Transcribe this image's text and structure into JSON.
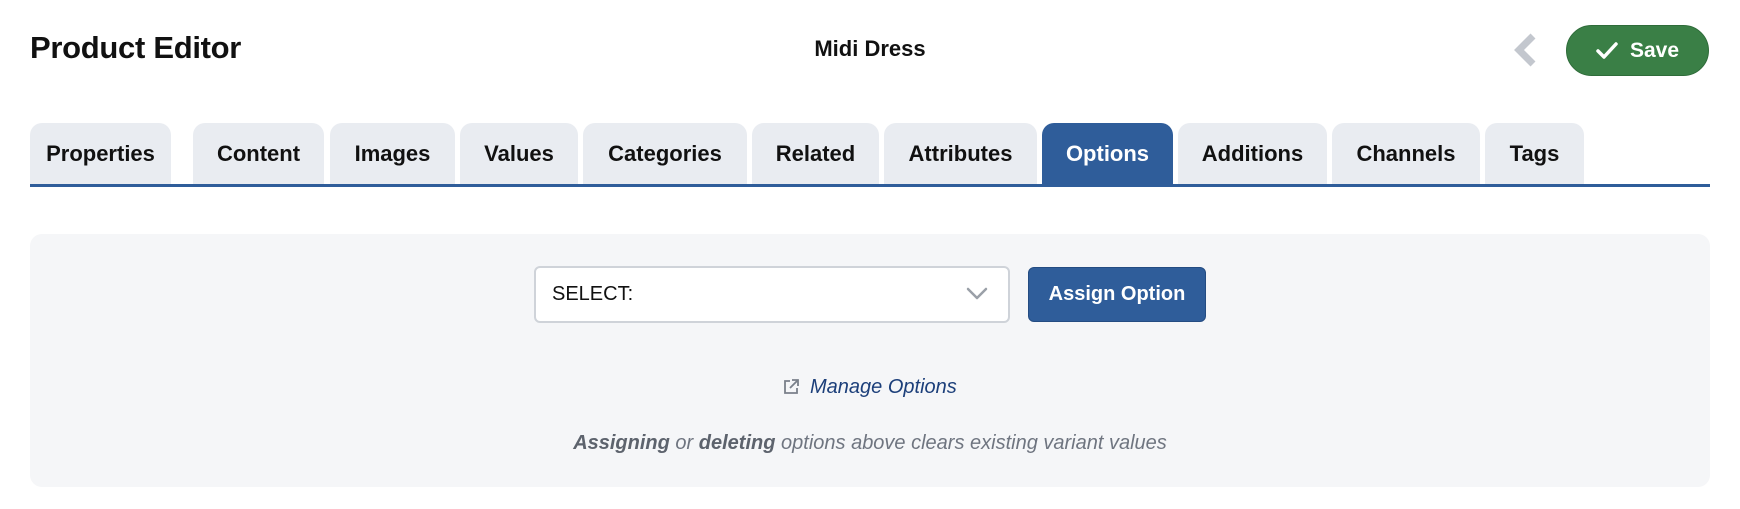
{
  "header": {
    "title": "Product Editor",
    "document_name": "Midi Dress",
    "back_icon": "chevron-left-icon",
    "save_label": "Save",
    "save_icon": "check-icon",
    "save_color": "#3a7f46"
  },
  "tabs": {
    "active": "Options",
    "items": [
      {
        "label": "Properties"
      },
      {
        "label": "Content"
      },
      {
        "label": "Images"
      },
      {
        "label": "Values"
      },
      {
        "label": "Categories"
      },
      {
        "label": "Related"
      },
      {
        "label": "Attributes"
      },
      {
        "label": "Options"
      },
      {
        "label": "Additions"
      },
      {
        "label": "Channels"
      },
      {
        "label": "Tags"
      }
    ],
    "accent_color": "#2f5d9a"
  },
  "options_panel": {
    "select_value": "SELECT:",
    "assign_label": "Assign Option",
    "manage_link_label": "Manage Options",
    "manage_link_icon": "external-link-icon",
    "note": {
      "word1": "Assigning",
      "connector": "or",
      "word2": "deleting",
      "rest": "options above clears existing variant values"
    }
  }
}
